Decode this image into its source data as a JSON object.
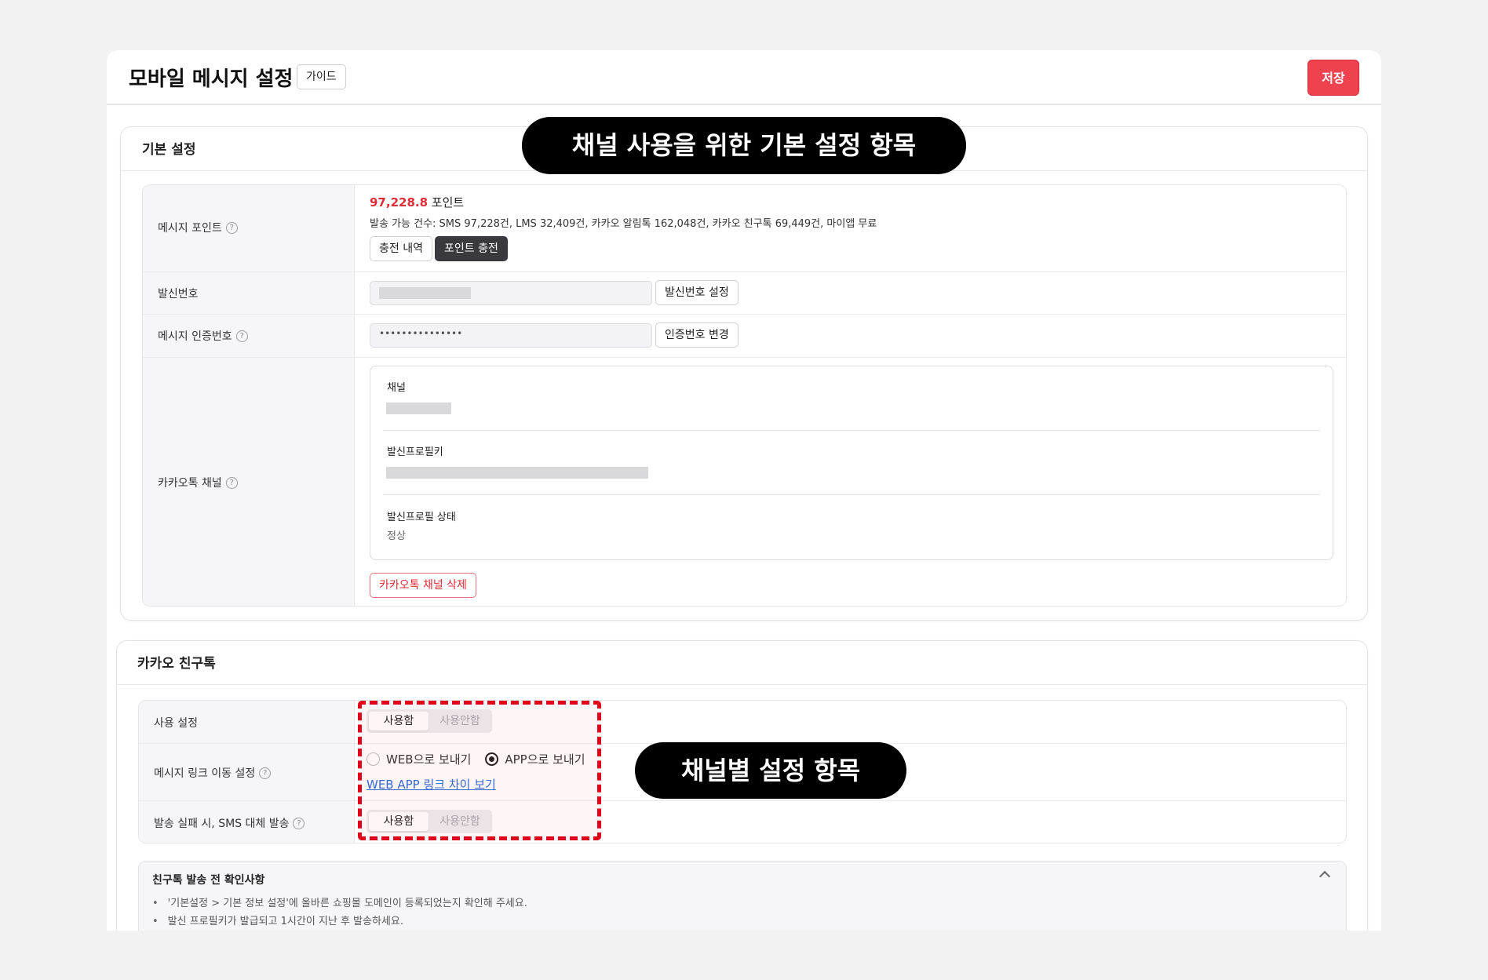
{
  "header": {
    "title": "모바일 메시지 설정",
    "guide_label": "가이드",
    "save_label": "저장"
  },
  "basic": {
    "section_title": "기본 설정",
    "points": {
      "label": "메시지 포인트",
      "value": "97,228.8",
      "unit": " 포인트",
      "detail": "발송 가능 건수: SMS 97,228건, LMS 32,409건, 카카오 알림톡 162,048건, 카카오 친구톡 69,449건, 마이앱 무료",
      "history_label": "충전 내역",
      "charge_label": "포인트 충전"
    },
    "sender": {
      "label": "발신번호",
      "setting_label": "발신번호 설정"
    },
    "auth": {
      "label": "메시지 인증번호",
      "value": "•••••••••••••••",
      "change_label": "인증번호 변경"
    },
    "kakao_channel": {
      "label": "카카오톡 채널",
      "channel_label": "채널",
      "profile_key_label": "발신프로필키",
      "profile_status_label": "발신프로필 상태",
      "profile_status_value": "정상",
      "delete_label": "카카오톡 채널 삭제"
    }
  },
  "friendtalk": {
    "section_title": "카카오 친구톡",
    "usage": {
      "label": "사용 설정",
      "on": "사용함",
      "off": "사용안함"
    },
    "link": {
      "label": "메시지 링크 이동 설정",
      "web": "WEB으로 보내기",
      "app": "APP으로 보내기",
      "selected": "app",
      "diff_link": "WEB APP 링크 차이 보기"
    },
    "sms_fallback": {
      "label": "발송 실패 시, SMS 대체 발송",
      "on": "사용함",
      "off": "사용안함"
    },
    "notice": {
      "title": "친구톡 발송 전 확인사항",
      "items": [
        "'기본설정 > 기본 정보 설정'에 올바른 쇼핑몰 도메인이 등록되었는지 확인해 주세요.",
        "발신 프로필키가 발급되고 1시간이 지난 후 발송하세요."
      ]
    }
  },
  "annotations": {
    "basic_callout": "채널 사용을 위한 기본 설정 항목",
    "channel_callout": "채널별 설정 항목"
  },
  "colors": {
    "accent": "#f0424e",
    "points": "#e02a36",
    "link": "#2f6bd9",
    "annotation_dash": "#e3001b"
  }
}
